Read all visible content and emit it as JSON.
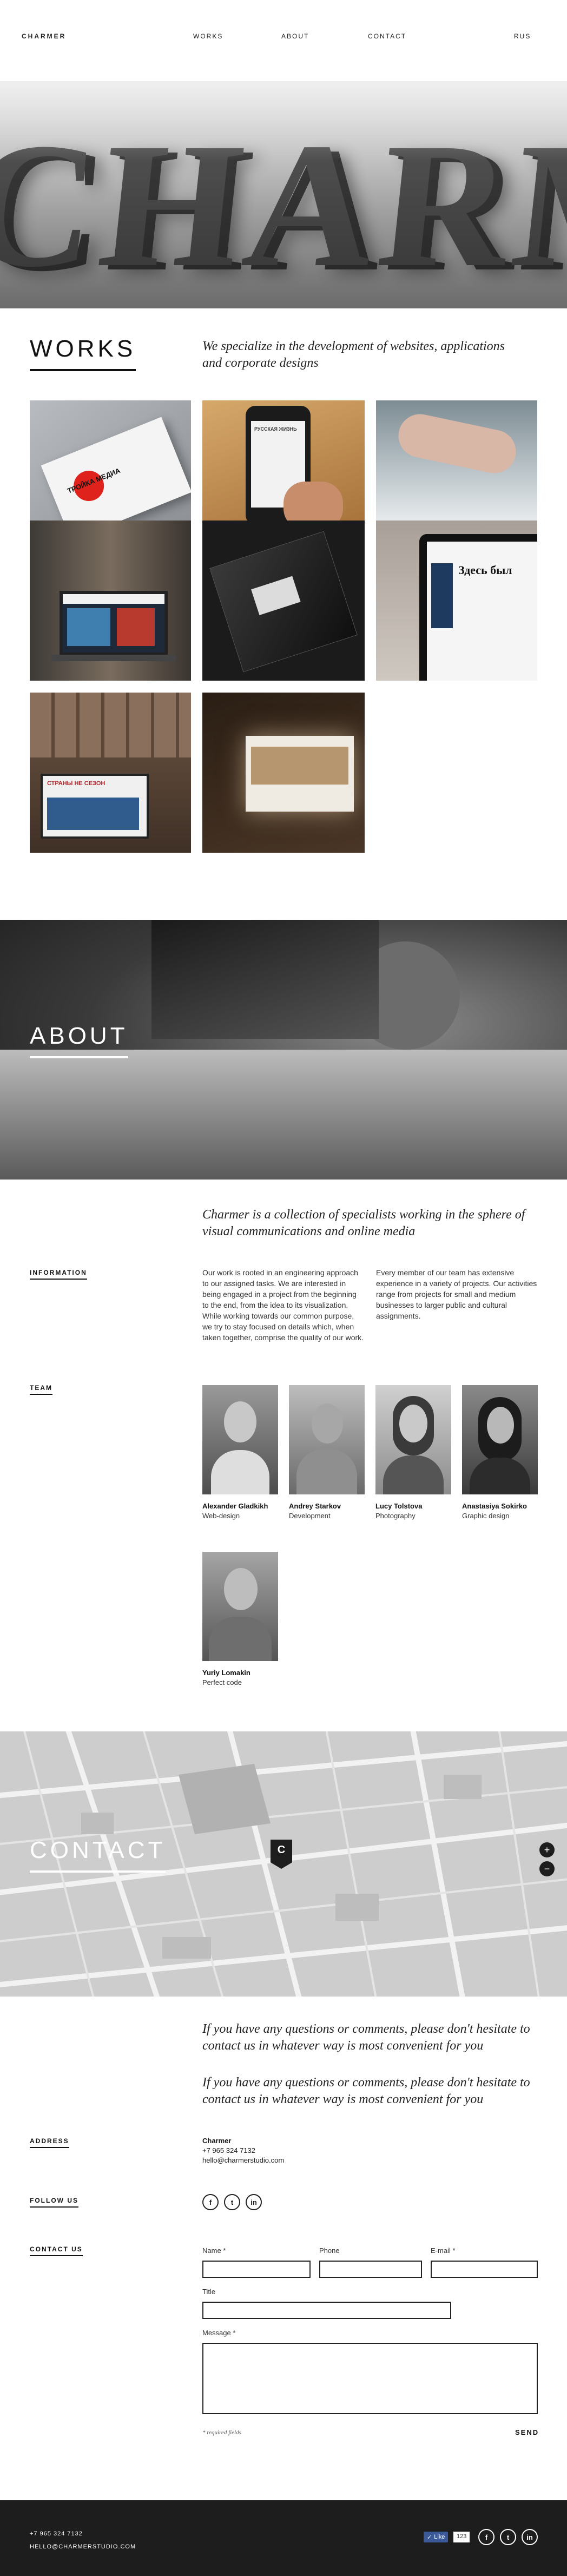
{
  "header": {
    "logo": "CHARMER",
    "nav": [
      "WORKS",
      "ABOUT",
      "CONTACT"
    ],
    "lang": "RUS"
  },
  "works": {
    "title": "WORKS",
    "lead": "We specialize in the development of websites, applications and corporate designs",
    "tiles": [
      {
        "name": "business-cards",
        "text": "ТРОЙКА МЕДИА"
      },
      {
        "name": "phone-app",
        "text": "РУССКАЯ ЖИЗНЬ"
      },
      {
        "name": "hand-texture",
        "text": ""
      },
      {
        "name": "laptop-site",
        "text": ""
      },
      {
        "name": "dark-packaging",
        "text": ""
      },
      {
        "name": "tablet-site",
        "text": "Здесь был"
      },
      {
        "name": "monitor-site",
        "text": "СТРАНЫ НЕ СЕЗОН"
      },
      {
        "name": "hotel-site",
        "text": ""
      }
    ]
  },
  "about": {
    "title": "ABOUT",
    "lead": "Charmer is a collection of specialists working in the sphere of visual communications and online media",
    "information_label": "INFORMATION",
    "info_col1": "Our work is rooted in an engineering approach to our assigned tasks. We are interested in being engaged in a project from the beginning to the end, from the idea to its visualization. While working towards our common purpose, we try to stay focused on details which, when taken together, comprise the quality of our work.",
    "info_col2": "Every member of our team has extensive experience in a variety of projects. Our activities range from projects for small and medium businesses to larger public and cultural assignments.",
    "team_label": "TEAM",
    "team": [
      {
        "name": "Alexander Gladkikh",
        "role": "Web-design"
      },
      {
        "name": "Andrey Starkov",
        "role": "Development"
      },
      {
        "name": "Lucy Tolstova",
        "role": "Photography"
      },
      {
        "name": "Anastasiya Sokirko",
        "role": "Graphic design"
      },
      {
        "name": "Yuriy Lomakin",
        "role": "Perfect code"
      }
    ]
  },
  "contact": {
    "title": "CONTACT",
    "lead1": "If you have any questions or comments, please don't hesitate to contact us in whatever way is most convenient for you",
    "lead2": "If you have any questions or comments, please don't hesitate to contact us in whatever way is most convenient for you",
    "address_label": "ADDRESS",
    "company": "Charmer",
    "phone": "+7 965 324 7132",
    "email": "hello@charmerstudio.com",
    "follow_label": "FOLLOW US",
    "contact_label": "CONTACT US",
    "form": {
      "name_label": "Name *",
      "phone_label": "Phone",
      "email_label": "E-mail *",
      "title_label": "Title",
      "message_label": "Message *",
      "required_note": "* required fields",
      "send_label": "SEND"
    }
  },
  "map": {
    "marker_letter": "C",
    "zoom_in": "+",
    "zoom_out": "−"
  },
  "footer": {
    "phone": "+7 965 324 7132",
    "email": "HELLO@CHARMERSTUDIO.COM",
    "like_label": "Like",
    "like_count": "123",
    "social": [
      "f",
      "t",
      "in"
    ]
  }
}
